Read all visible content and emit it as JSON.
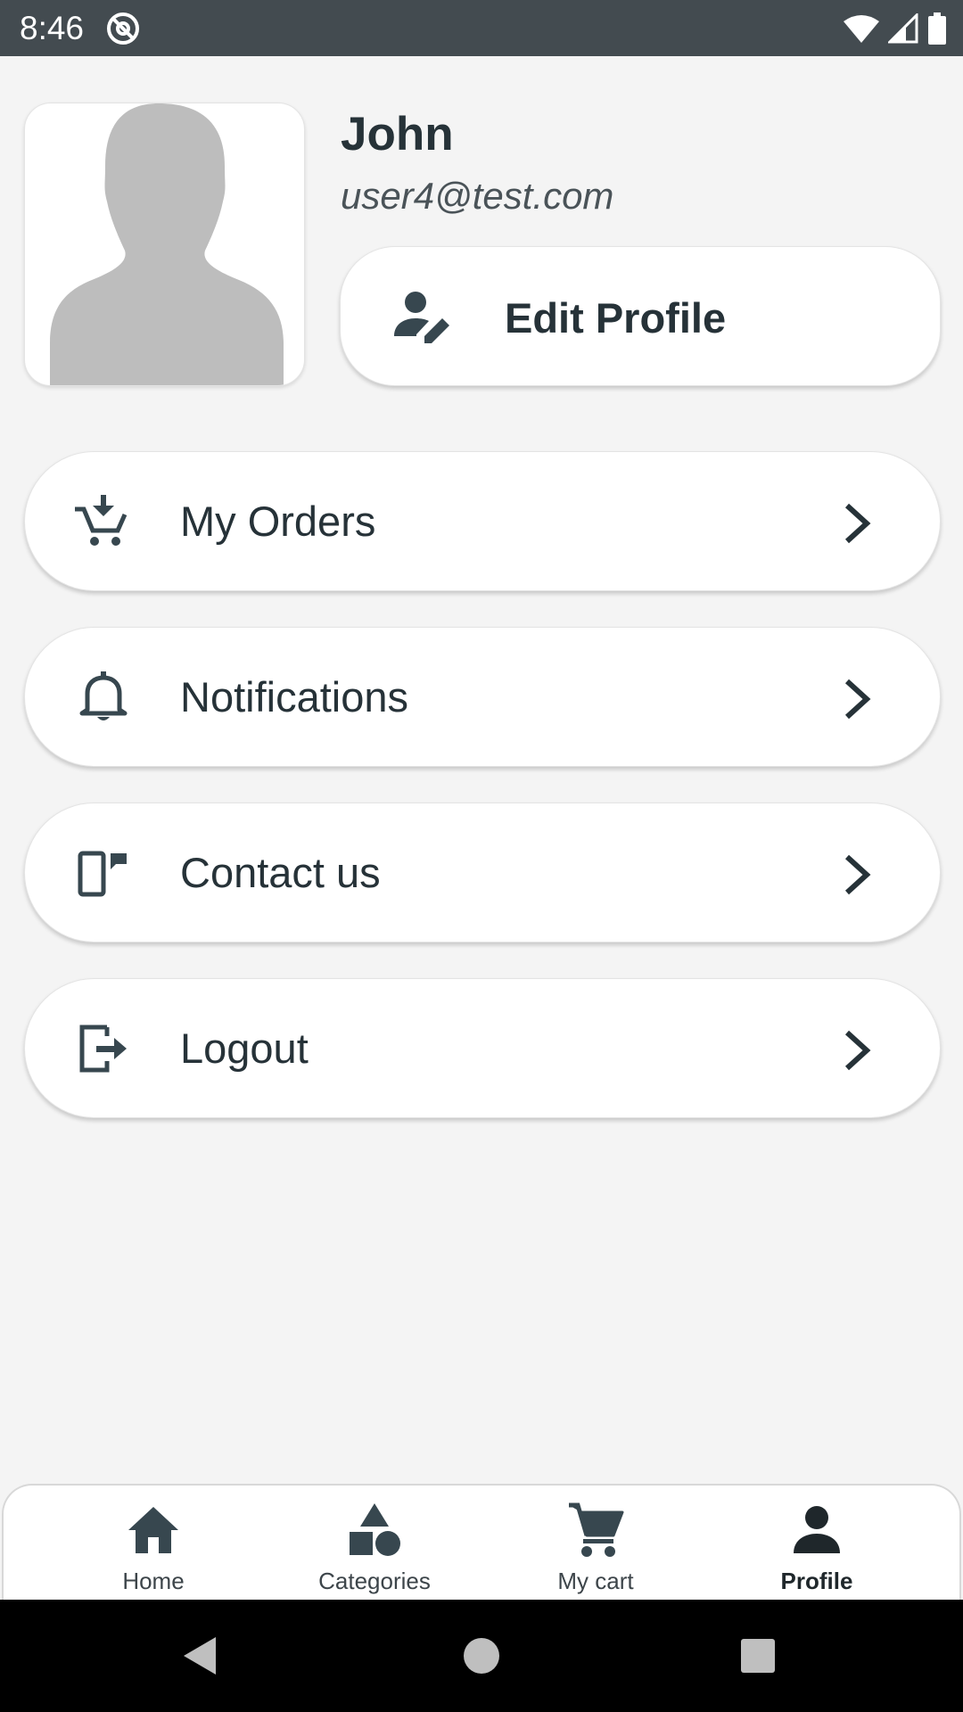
{
  "status_bar": {
    "time": "8:46",
    "icons": [
      "at-sign-icon",
      "wifi-icon",
      "signal-icon",
      "battery-icon"
    ]
  },
  "profile": {
    "name": "John",
    "email": "user4@test.com",
    "edit_label": "Edit Profile",
    "avatar_icon": "person-silhouette-icon"
  },
  "menu": {
    "items": [
      {
        "label": "My Orders",
        "icon": "cart-download-icon"
      },
      {
        "label": "Notifications",
        "icon": "bell-icon"
      },
      {
        "label": "Contact us",
        "icon": "phone-message-icon"
      },
      {
        "label": "Logout",
        "icon": "logout-icon"
      }
    ]
  },
  "bottom_nav": {
    "items": [
      {
        "label": "Home",
        "icon": "home-icon",
        "active": false
      },
      {
        "label": "Categories",
        "icon": "shapes-icon",
        "active": false
      },
      {
        "label": "My cart",
        "icon": "cart-icon",
        "active": false
      },
      {
        "label": "Profile",
        "icon": "person-icon",
        "active": true
      }
    ]
  },
  "colors": {
    "status_bar": "#434b50",
    "background": "#f4f4f4",
    "card": "#ffffff",
    "icon": "#37474f",
    "text": "#263238"
  }
}
